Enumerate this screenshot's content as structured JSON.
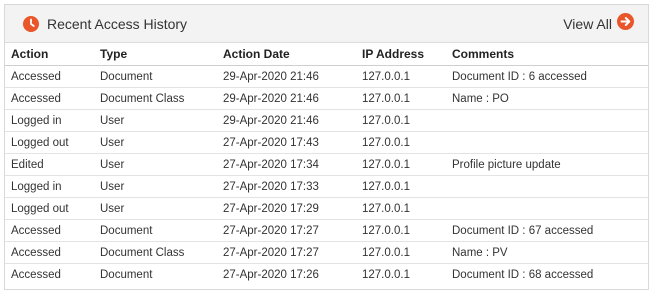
{
  "panel": {
    "title": "Recent Access History",
    "view_all_label": "View All",
    "icons": {
      "title": "clock-icon",
      "view_all": "arrow-circle-right-icon"
    },
    "accent_color": "#e8562a"
  },
  "table": {
    "columns": [
      "Action",
      "Type",
      "Action Date",
      "IP Address",
      "Comments"
    ],
    "rows": [
      [
        "Accessed",
        "Document",
        "29-Apr-2020 21:46",
        "127.0.0.1",
        "Document ID : 6 accessed"
      ],
      [
        "Accessed",
        "Document Class",
        "29-Apr-2020 21:46",
        "127.0.0.1",
        "Name : PO"
      ],
      [
        "Logged in",
        "User",
        "29-Apr-2020 21:46",
        "127.0.0.1",
        ""
      ],
      [
        "Logged out",
        "User",
        "27-Apr-2020 17:43",
        "127.0.0.1",
        ""
      ],
      [
        "Edited",
        "User",
        "27-Apr-2020 17:34",
        "127.0.0.1",
        "Profile picture update"
      ],
      [
        "Logged in",
        "User",
        "27-Apr-2020 17:33",
        "127.0.0.1",
        ""
      ],
      [
        "Logged out",
        "User",
        "27-Apr-2020 17:29",
        "127.0.0.1",
        ""
      ],
      [
        "Accessed",
        "Document",
        "27-Apr-2020 17:27",
        "127.0.0.1",
        "Document ID : 67 accessed"
      ],
      [
        "Accessed",
        "Document Class",
        "27-Apr-2020 17:27",
        "127.0.0.1",
        "Name : PV"
      ],
      [
        "Accessed",
        "Document",
        "27-Apr-2020 17:26",
        "127.0.0.1",
        "Document ID : 68 accessed"
      ]
    ]
  }
}
